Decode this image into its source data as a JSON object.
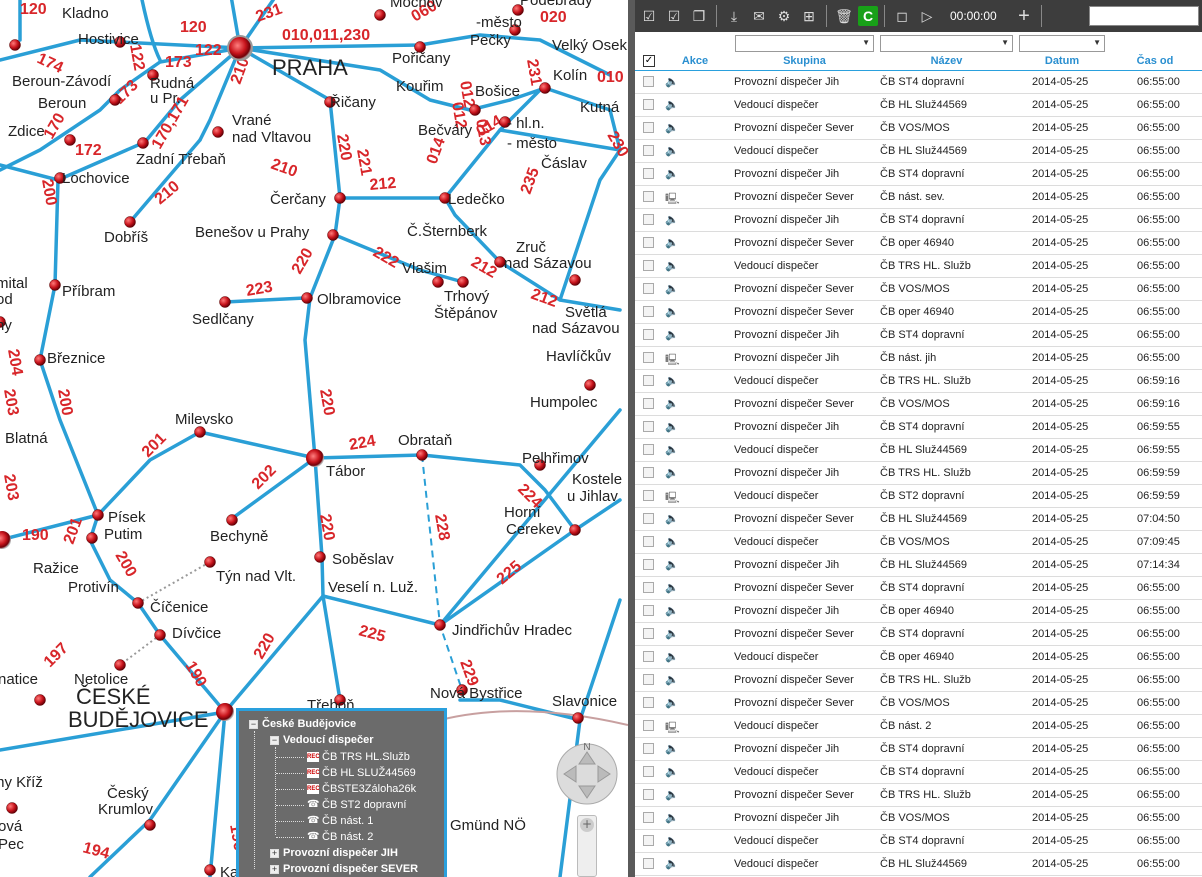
{
  "map": {
    "cities": [
      {
        "name": "Kladno"
      },
      {
        "name": "Hostivice"
      },
      {
        "name": "Beroun-Závodí"
      },
      {
        "name": "Beroun"
      },
      {
        "name": "Rudná"
      },
      {
        "name": "u Pr."
      },
      {
        "name": "Zdice"
      },
      {
        "name": "Lochovice"
      },
      {
        "name": "Zadní Třebaň"
      },
      {
        "name": "Vrané"
      },
      {
        "name": "nad Vltavou"
      },
      {
        "name": "Řičany"
      },
      {
        "name": "Pořičany"
      },
      {
        "name": "Pečky"
      },
      {
        "name": "Velký Osek"
      },
      {
        "name": "Kouřim"
      },
      {
        "name": "Bošice"
      },
      {
        "name": "Kolín"
      },
      {
        "name": "Kutná"
      },
      {
        "name": "Bečváry"
      },
      {
        "name": "- hl.n."
      },
      {
        "name": "- město"
      },
      {
        "name": "Čáslav"
      },
      {
        "name": "Čerčany"
      },
      {
        "name": "Ledečko"
      },
      {
        "name": "Dobříš"
      },
      {
        "name": "Benešov u Prahy"
      },
      {
        "name": "Č.Šternberk"
      },
      {
        "name": "Zruč"
      },
      {
        "name": "nad Sázavou"
      },
      {
        "name": "Vlašim"
      },
      {
        "name": "Trhový"
      },
      {
        "name": "Štěpánov"
      },
      {
        "name": "Příbram"
      },
      {
        "name": "Sedlčany"
      },
      {
        "name": "Olbramovice"
      },
      {
        "name": "Světlá"
      },
      {
        "name": "nad Sázavou"
      },
      {
        "name": "Havlíčkův"
      },
      {
        "name": "Březnice"
      },
      {
        "name": "Humpolec"
      },
      {
        "name": "Blatná"
      },
      {
        "name": "Milevsko"
      },
      {
        "name": "Obrataň"
      },
      {
        "name": "Pelhřimov"
      },
      {
        "name": "Tábor"
      },
      {
        "name": "Kostele"
      },
      {
        "name": "u Jihlav"
      },
      {
        "name": "Písek"
      },
      {
        "name": "Putim"
      },
      {
        "name": "Bechyně"
      },
      {
        "name": "Horní"
      },
      {
        "name": "Cerekev"
      },
      {
        "name": "Ražice"
      },
      {
        "name": "Soběslav"
      },
      {
        "name": "Protivín"
      },
      {
        "name": "Týn nad Vlt."
      },
      {
        "name": "Veselí n. Luž."
      },
      {
        "name": "Číčenice"
      },
      {
        "name": "Dívčice"
      },
      {
        "name": "Jindřichův Hradec"
      },
      {
        "name": "Netolice"
      },
      {
        "name": "natice"
      },
      {
        "name": "Třeboň"
      },
      {
        "name": "Nová Bystřice"
      },
      {
        "name": "Slavonice"
      },
      {
        "name": "my Kříž"
      },
      {
        "name": "Český"
      },
      {
        "name": "Krumlov"
      },
      {
        "name": "ová"
      },
      {
        "name": "Pec"
      },
      {
        "name": "mital"
      },
      {
        "name": "od"
      },
      {
        "name": "ny"
      },
      {
        "name": "-město"
      },
      {
        "name": "Podebrady"
      },
      {
        "name": "Mochov"
      },
      {
        "name": "Gmünd NÖ"
      },
      {
        "name": "Ka"
      }
    ],
    "big_cities": [
      {
        "name": "PRAHA"
      },
      {
        "name": "ČESKÉ"
      },
      {
        "name": "BUDĚJOVICE"
      }
    ],
    "routes": [
      "120",
      "120",
      "122",
      "122",
      "173",
      "173",
      "174",
      "170",
      "170,171",
      "172",
      "210",
      "210",
      "210",
      "231",
      "010,011,230",
      "060",
      "020",
      "231",
      "010",
      "012",
      "012",
      "013",
      "014",
      "014",
      "230",
      "220",
      "221",
      "212",
      "235",
      "222",
      "212",
      "212",
      "223",
      "220",
      "200",
      "200",
      "204",
      "203",
      "201",
      "224",
      "220",
      "202",
      "228",
      "224",
      "203",
      "190",
      "201",
      "200",
      "225",
      "220",
      "225",
      "229",
      "197",
      "190",
      "196",
      "194",
      "220"
    ]
  },
  "tree": {
    "root": "České Budějovice",
    "group1": "Vedoucí dispečer",
    "items": [
      "ČB TRS HL.Služb",
      "ČB HL SLUŽ44569",
      "ČBSTE3Záloha26k",
      "ČB ST2 dopravní",
      "ČB nást. 1",
      "ČB nást. 2"
    ],
    "group2": "Provozní dispečer JIH",
    "group3": "Provozní dispečer SEVER",
    "rec_label": "REC"
  },
  "pan": {
    "north": "N"
  },
  "toolbar": {
    "timer": "00:00:00",
    "refresh_label": "C",
    "add_label": "+"
  },
  "table": {
    "headers": {
      "akce": "Akce",
      "skupina": "Skupina",
      "nazev": "Název",
      "datum": "Datum",
      "cas_od": "Čas od"
    },
    "rows": [
      {
        "icon": "speaker-icon",
        "group": "Provozní dispečer Jih",
        "name": "ČB ST4 dopravní",
        "date": "2014-05-25",
        "time": "06:55:00"
      },
      {
        "icon": "speaker-icon",
        "group": "Vedoucí dispečer",
        "name": "ČB HL Služ44569",
        "date": "2014-05-25",
        "time": "06:55:00"
      },
      {
        "icon": "speaker-icon",
        "group": "Provozní dispečer Sever",
        "name": "ČB VOS/MOS",
        "date": "2014-05-25",
        "time": "06:55:00"
      },
      {
        "icon": "speaker-icon",
        "group": "Vedoucí dispečer",
        "name": "ČB HL Služ44569",
        "date": "2014-05-25",
        "time": "06:55:00"
      },
      {
        "icon": "speaker-icon",
        "group": "Provozní dispečer Jih",
        "name": "ČB ST4 dopravní",
        "date": "2014-05-25",
        "time": "06:55:00"
      },
      {
        "icon": "monitor-icon",
        "group": "Provozní dispečer Sever",
        "name": "ČB nást. sev.",
        "date": "2014-05-25",
        "time": "06:55:00"
      },
      {
        "icon": "speaker-icon",
        "group": "Provozní dispečer Jih",
        "name": "ČB ST4 dopravní",
        "date": "2014-05-25",
        "time": "06:55:00"
      },
      {
        "icon": "speaker-icon",
        "group": "Provozní dispečer Sever",
        "name": "ČB oper 46940",
        "date": "2014-05-25",
        "time": "06:55:00"
      },
      {
        "icon": "speaker-icon",
        "group": "Vedoucí dispečer",
        "name": "ČB TRS HL. Služb",
        "date": "2014-05-25",
        "time": "06:55:00"
      },
      {
        "icon": "speaker-icon",
        "group": "Provozní dispečer Sever",
        "name": "ČB VOS/MOS",
        "date": "2014-05-25",
        "time": "06:55:00"
      },
      {
        "icon": "speaker-icon",
        "group": "Provozní dispečer Sever",
        "name": "ČB oper 46940",
        "date": "2014-05-25",
        "time": "06:55:00"
      },
      {
        "icon": "speaker-icon",
        "group": "Provozní dispečer Jih",
        "name": "ČB ST4 dopravní",
        "date": "2014-05-25",
        "time": "06:55:00"
      },
      {
        "icon": "monitor-icon",
        "group": "Provozní dispečer Jih",
        "name": "ČB nást. jih",
        "date": "2014-05-25",
        "time": "06:55:00"
      },
      {
        "icon": "speaker-icon",
        "group": "Vedoucí dispečer",
        "name": "ČB TRS HL. Služb",
        "date": "2014-05-25",
        "time": "06:59:16"
      },
      {
        "icon": "speaker-icon",
        "group": "Provozní dispečer Sever",
        "name": "ČB VOS/MOS",
        "date": "2014-05-25",
        "time": "06:59:16"
      },
      {
        "icon": "speaker-icon",
        "group": "Provozní dispečer Jih",
        "name": "ČB ST4 dopravní",
        "date": "2014-05-25",
        "time": "06:59:55"
      },
      {
        "icon": "speaker-icon",
        "group": "Vedoucí dispečer",
        "name": "ČB HL Služ44569",
        "date": "2014-05-25",
        "time": "06:59:55"
      },
      {
        "icon": "speaker-icon",
        "group": "Provozní dispečer Jih",
        "name": "ČB TRS HL. Služb",
        "date": "2014-05-25",
        "time": "06:59:59"
      },
      {
        "icon": "monitor-icon",
        "group": "Vedoucí dispečer",
        "name": "ČB ST2 dopravní",
        "date": "2014-05-25",
        "time": "06:59:59"
      },
      {
        "icon": "speaker-icon",
        "group": "Provozní dispečer Sever",
        "name": "ČB HL Služ44569",
        "date": "2014-05-25",
        "time": "07:04:50"
      },
      {
        "icon": "speaker-icon",
        "group": "Vedoucí dispečer",
        "name": "ČB VOS/MOS",
        "date": "2014-05-25",
        "time": "07:09:45"
      },
      {
        "icon": "speaker-icon",
        "group": "Provozní dispečer Jih",
        "name": "ČB HL Služ44569",
        "date": "2014-05-25",
        "time": "07:14:34"
      },
      {
        "icon": "speaker-icon",
        "group": "Provozní dispečer Sever",
        "name": "ČB ST4 dopravní",
        "date": "2014-05-25",
        "time": "06:55:00"
      },
      {
        "icon": "speaker-icon",
        "group": "Provozní dispečer Jih",
        "name": "ČB oper 46940",
        "date": "2014-05-25",
        "time": "06:55:00"
      },
      {
        "icon": "speaker-icon",
        "group": "Provozní dispečer Sever",
        "name": "ČB ST4 dopravní",
        "date": "2014-05-25",
        "time": "06:55:00"
      },
      {
        "icon": "speaker-icon",
        "group": "Vedoucí dispečer",
        "name": "ČB oper 46940",
        "date": "2014-05-25",
        "time": "06:55:00"
      },
      {
        "icon": "speaker-icon",
        "group": "Provozní dispečer Sever",
        "name": "ČB TRS HL. Služb",
        "date": "2014-05-25",
        "time": "06:55:00"
      },
      {
        "icon": "speaker-icon",
        "group": "Provozní dispečer Sever",
        "name": "ČB VOS/MOS",
        "date": "2014-05-25",
        "time": "06:55:00"
      },
      {
        "icon": "monitor-icon",
        "group": "Vedoucí dispečer",
        "name": "ČB nást. 2",
        "date": "2014-05-25",
        "time": "06:55:00"
      },
      {
        "icon": "speaker-icon",
        "group": "Provozní dispečer Jih",
        "name": "ČB ST4 dopravní",
        "date": "2014-05-25",
        "time": "06:55:00"
      },
      {
        "icon": "speaker-icon",
        "group": "Vedoucí dispečer",
        "name": "ČB ST4 dopravní",
        "date": "2014-05-25",
        "time": "06:55:00"
      },
      {
        "icon": "speaker-icon",
        "group": "Provozní dispečer Sever",
        "name": "ČB TRS HL. Služb",
        "date": "2014-05-25",
        "time": "06:55:00"
      },
      {
        "icon": "speaker-icon",
        "group": "Provozní dispečer Jih",
        "name": "ČB VOS/MOS",
        "date": "2014-05-25",
        "time": "06:55:00"
      },
      {
        "icon": "speaker-icon",
        "group": "Vedoucí dispečer",
        "name": "ČB ST4 dopravní",
        "date": "2014-05-25",
        "time": "06:55:00"
      },
      {
        "icon": "speaker-icon",
        "group": "Vedoucí dispečer",
        "name": "ČB HL Služ44569",
        "date": "2014-05-25",
        "time": "06:55:00"
      }
    ]
  },
  "colors": {
    "rail": "#2a9fd6",
    "route_number": "#d8262a",
    "station": "#b0141c",
    "accent": "#2a8fd0"
  }
}
